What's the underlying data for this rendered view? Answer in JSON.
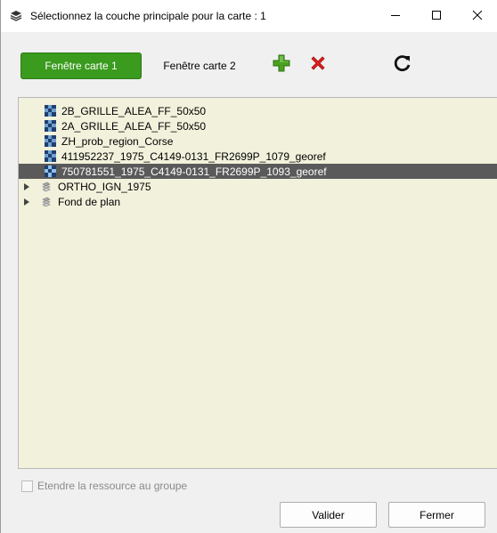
{
  "window": {
    "title": "Sélectionnez la couche principale pour la carte : 1",
    "minimize_icon": "minimize-icon",
    "maximize_icon": "maximize-icon",
    "close_icon": "close-icon"
  },
  "toolbar": {
    "tabs": [
      {
        "label": "Fenêtre carte 1",
        "active": true
      },
      {
        "label": "Fenêtre carte 2",
        "active": false
      }
    ],
    "add_icon": "green-plus-icon",
    "remove_icon": "red-x-icon",
    "refresh_icon": "refresh-icon"
  },
  "tree": {
    "items": [
      {
        "label": "2B_GRILLE_ALEA_FF_50x50",
        "icon": "raster-layer-icon",
        "selected": false
      },
      {
        "label": "2A_GRILLE_ALEA_FF_50x50",
        "icon": "raster-layer-icon",
        "selected": false
      },
      {
        "label": "ZH_prob_region_Corse",
        "icon": "raster-layer-icon",
        "selected": false
      },
      {
        "label": "411952237_1975_C4149-0131_FR2699P_1079_georef",
        "icon": "raster-layer-icon",
        "selected": false
      },
      {
        "label": "750781551_1975_C4149-0131_FR2699P_1093_georef",
        "icon": "raster-layer-icon",
        "selected": true
      },
      {
        "label": "ORTHO_IGN_1975",
        "icon": "group-icon",
        "expander": true
      },
      {
        "label": "Fond de plan",
        "icon": "group-icon",
        "expander": true
      }
    ]
  },
  "footer": {
    "checkbox_label": "Etendre la ressource au groupe",
    "checkbox_checked": false,
    "validate_label": "Valider",
    "close_label": "Fermer"
  },
  "colors": {
    "active_tab": "#3a9b1e",
    "tree_background": "#f2f1dc",
    "selection": "#5a5a5a"
  }
}
